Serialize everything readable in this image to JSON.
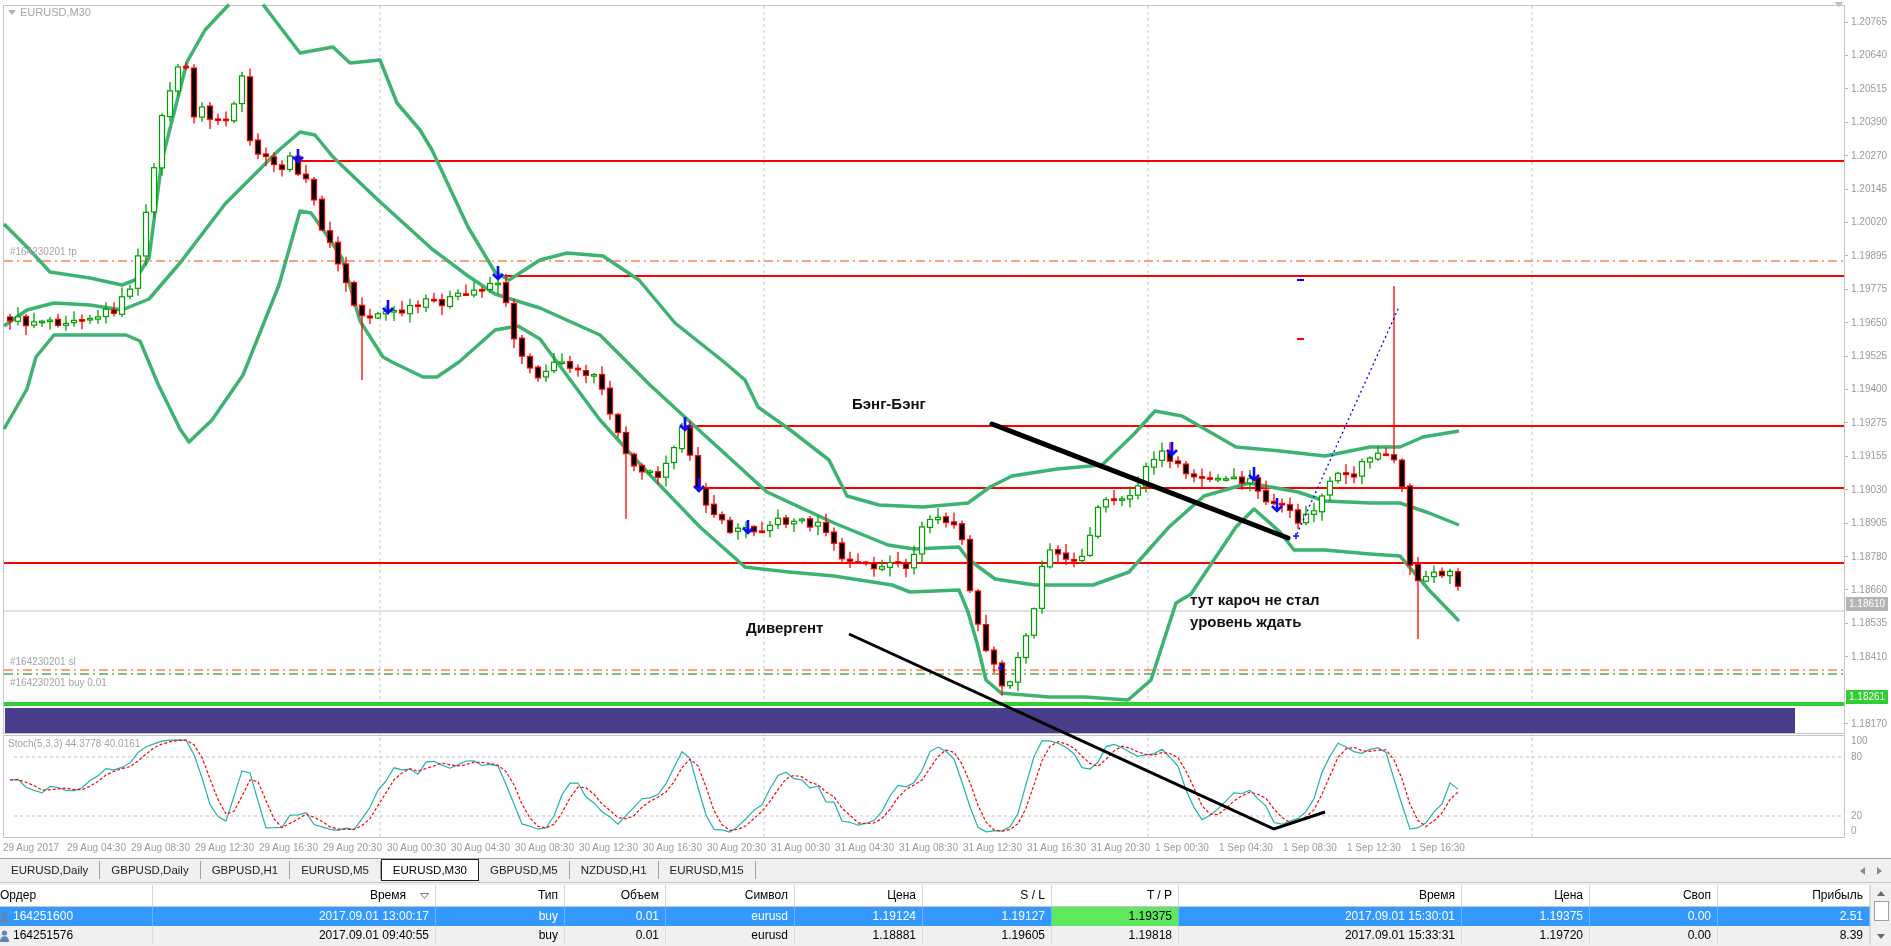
{
  "chart": {
    "symbol": "EURUSD,M30",
    "order_lines": {
      "take_profit": "#164230201 tp",
      "stop_loss": "#164230201 sl",
      "open": "#164230201 buy 0.01"
    },
    "annotations": [
      "Бэнг-Бэнг",
      "Дивергент",
      "тут кароч не стал уровень ждать"
    ],
    "price_axis": [
      "1.20765",
      "1.20640",
      "1.20515",
      "1.20390",
      "1.20270",
      "1.20145",
      "1.20020",
      "1.19895",
      "1.19775",
      "1.19650",
      "1.19525",
      "1.19400",
      "1.19275",
      "1.19155",
      "1.19030",
      "1.18905",
      "1.18780",
      "1.18660",
      "1.18535",
      "1.18410",
      "1.18170"
    ],
    "price_markers": [
      {
        "kind": "bid",
        "text": "1.18610"
      },
      {
        "kind": "level",
        "text": "1.18261"
      }
    ],
    "indicator_label": "Stoch(5,3,3) 44.3778 40.0161",
    "indicator_axis": [
      "100",
      "80",
      "20",
      "0"
    ],
    "time_axis": [
      "29 Aug 2017",
      "29 Aug 04:30",
      "29 Aug 08:30",
      "29 Aug 12:30",
      "29 Aug 16:30",
      "29 Aug 20:30",
      "30 Aug 00:30",
      "30 Aug 04:30",
      "30 Aug 08:30",
      "30 Aug 12:30",
      "30 Aug 16:30",
      "30 Aug 20:30",
      "31 Aug 00:30",
      "31 Aug 04:30",
      "31 Aug 08:30",
      "31 Aug 12:30",
      "31 Aug 16:30",
      "31 Aug 20:30",
      "1 Sep 00:30",
      "1 Sep 04:30",
      "1 Sep 08:30",
      "1 Sep 12:30",
      "1 Sep 16:30"
    ]
  },
  "tabs": [
    {
      "label": "EURUSD,Daily",
      "selected": false
    },
    {
      "label": "GBPUSD,Daily",
      "selected": false
    },
    {
      "label": "GBPUSD,H1",
      "selected": false
    },
    {
      "label": "EURUSD,M5",
      "selected": false
    },
    {
      "label": "EURUSD,M30",
      "selected": true
    },
    {
      "label": "GBPUSD,M5",
      "selected": false
    },
    {
      "label": "NZDUSD,H1",
      "selected": false
    },
    {
      "label": "EURUSD,M15",
      "selected": false
    }
  ],
  "orders_table": {
    "columns": [
      {
        "label": "Ордер",
        "sorted": false
      },
      {
        "label": "Время",
        "sorted": true
      },
      {
        "label": "Тип",
        "sorted": false
      },
      {
        "label": "Объем",
        "sorted": false
      },
      {
        "label": "Символ",
        "sorted": false
      },
      {
        "label": "Цена",
        "sorted": false
      },
      {
        "label": "S / L",
        "sorted": false
      },
      {
        "label": "T / P",
        "sorted": false
      },
      {
        "label": "Время",
        "sorted": false
      },
      {
        "label": "Цена",
        "sorted": false
      },
      {
        "label": "Своп",
        "sorted": false
      },
      {
        "label": "Прибыль",
        "sorted": false
      }
    ],
    "rows": [
      {
        "selected": true,
        "tp_reached": true,
        "cells": [
          "164251600",
          "2017.09.01 13:00:17",
          "buy",
          "0.01",
          "eurusd",
          "1.19124",
          "1.19127",
          "1.19375",
          "2017.09.01 15:30:01",
          "1.19375",
          "0.00",
          "2.51"
        ]
      },
      {
        "selected": false,
        "tp_reached": false,
        "cells": [
          "164251576",
          "2017.09.01 09:40:55",
          "buy",
          "0.01",
          "eurusd",
          "1.18881",
          "1.19605",
          "1.19818",
          "2017.09.01 15:33:31",
          "1.19720",
          "0.00",
          "8.39"
        ]
      }
    ]
  }
}
